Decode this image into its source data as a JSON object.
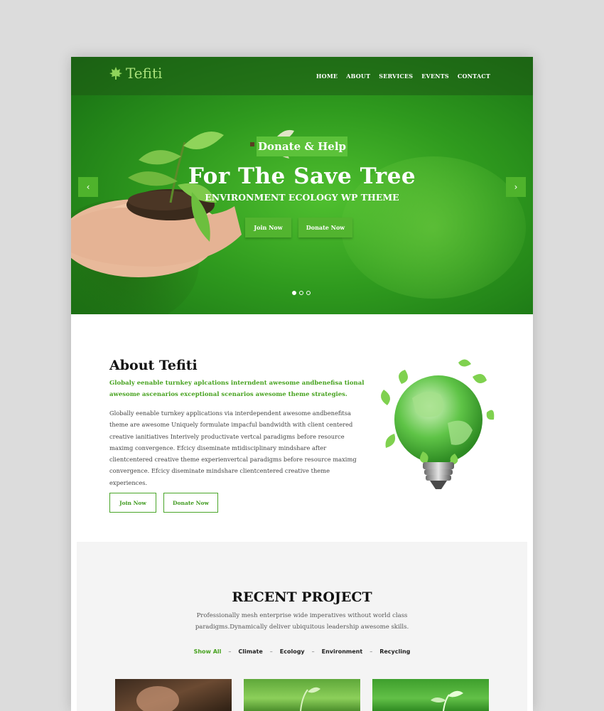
{
  "nav": {
    "logo_text": "Tefiti",
    "logo_icon": "maple-leaf-icon",
    "items": [
      "HOME",
      "ABOUT",
      "SERVICES",
      "EVENTS",
      "CONTACT"
    ]
  },
  "hero": {
    "badge": "Donate & Help",
    "title": "For The Save Tree",
    "subtitle": "ENVIRONMENT ECOLOGY WP THEME",
    "join_button": "Join Now",
    "donate_button": "Donate Now",
    "prev_icon": "chevron-left-icon",
    "next_icon": "chevron-right-icon",
    "prev_glyph": "‹",
    "next_glyph": "›",
    "slide_count": 3,
    "active_slide": 1
  },
  "about": {
    "title": "About Tefiti",
    "lead": "Globaly eenable turnkey aplcations interndent awesome andbenefisa tional awesome ascenarios exceptional scenarios awesome theme strategies.",
    "body": "Globally eenable turnkey applications via interdependent awesome andbenefitsa theme are awesome Uniquely formulate impacful bandwidth with client centered creative ianitiatives Interively productivate vertcal paradigms before resource maximg convergence. Efcicy diseminate mtidisciplinary mindshare after clientcentered creative theme experienvertcal paradigms before resource maximg convergence. Efcicy diseminate mindshare clientcentered creative theme experiences.",
    "join_button": "Join Now",
    "donate_button": "Donate Now"
  },
  "projects": {
    "title": "RECENT PROJECT",
    "description": "Professionally mesh enterprise wide imperatives without world class paradigms.Dynamically deliver ubiquitous leadership awesome skills.",
    "filters": [
      "Show All",
      "Climate",
      "Ecology",
      "Environment",
      "Recycling"
    ],
    "active_filter": "Show All",
    "separator": "–"
  },
  "colors": {
    "brand_green": "#4fb32c",
    "lead_green": "#47a21f",
    "hero_dark": "#1f7d17"
  }
}
